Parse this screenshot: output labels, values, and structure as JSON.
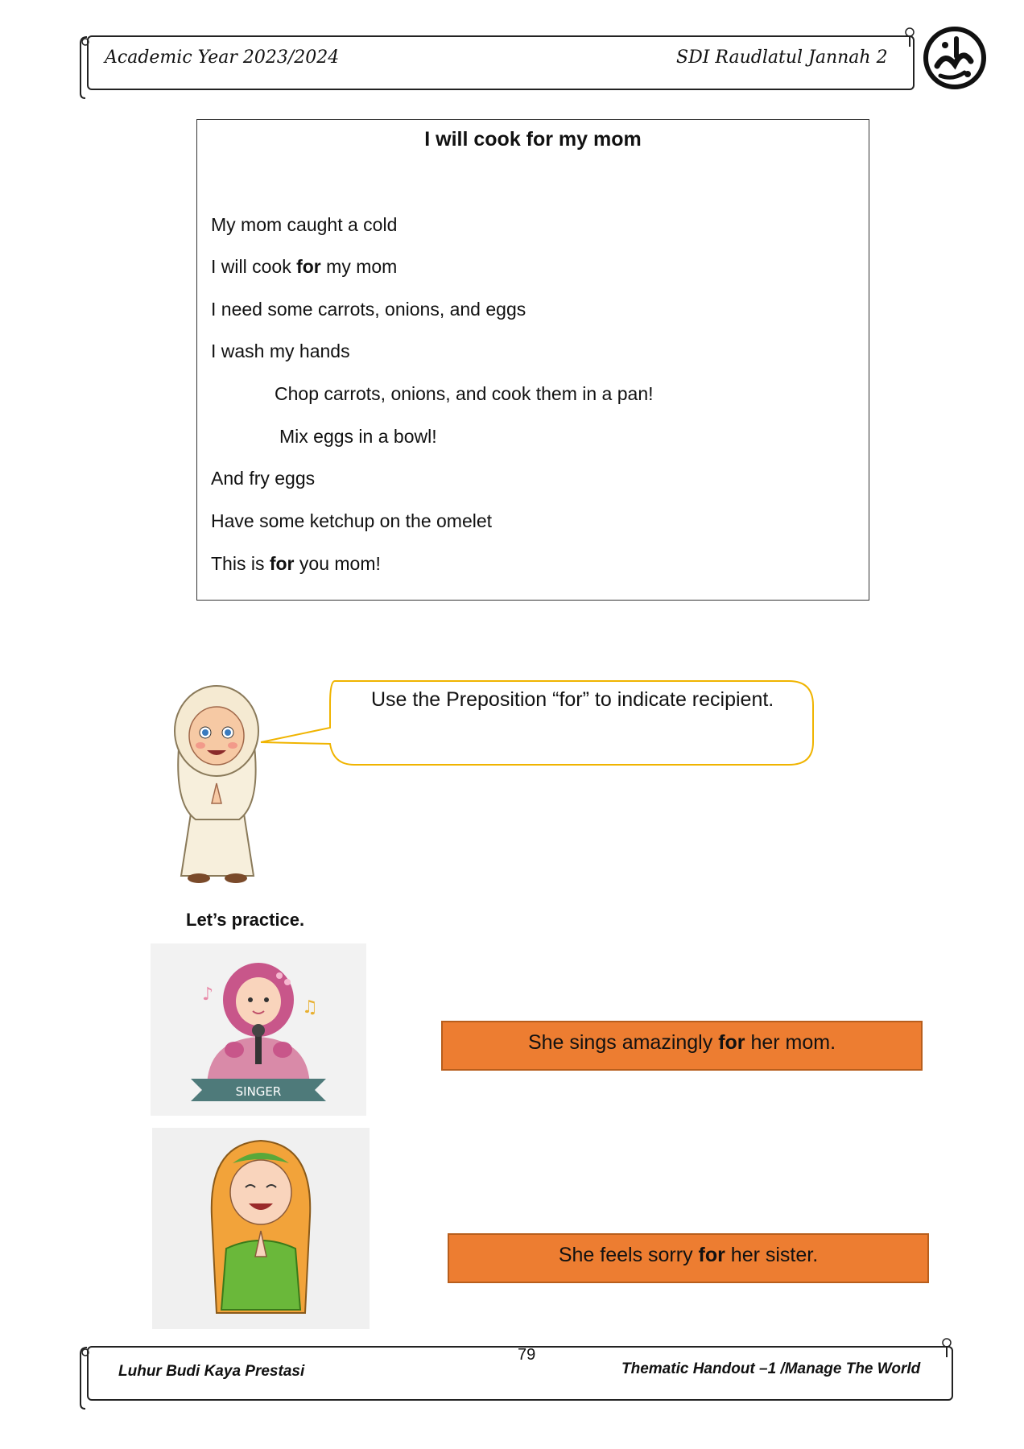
{
  "header": {
    "academic_year": "Academic Year 2023/2024",
    "school_name": "SDI  Raudlatul Jannah 2"
  },
  "story": {
    "title": "I will cook for my mom",
    "lines": [
      {
        "before": "My mom caught a cold",
        "bold": "",
        "after": ""
      },
      {
        "before": "I will cook ",
        "bold": "for",
        "after": " my mom"
      },
      {
        "before": "I need some carrots, onions, and eggs",
        "bold": "",
        "after": ""
      },
      {
        "before": "I wash my hands",
        "bold": "",
        "after": ""
      },
      {
        "before": "Chop carrots, onions, and cook them in a pan!",
        "bold": "",
        "after": ""
      },
      {
        "before": "Mix eggs in a bowl!",
        "bold": "",
        "after": ""
      },
      {
        "before": "And fry eggs",
        "bold": "",
        "after": ""
      },
      {
        "before": "Have some ketchup on the omelet",
        "bold": "",
        "after": ""
      },
      {
        "before": "This is ",
        "bold": "for",
        "after": " you mom!"
      }
    ]
  },
  "speech_bubble": {
    "text": "Use the Preposition “for” to indicate recipient."
  },
  "practice": {
    "title": "Let’s practice.",
    "singer_banner": "SINGER",
    "sentences": [
      {
        "before": "She sings amazingly ",
        "bold": "for",
        "after": " her mom."
      },
      {
        "before": "She feels sorry ",
        "bold": "for",
        "after": " her sister."
      }
    ]
  },
  "footer": {
    "motto": "Luhur Budi Kaya Prestasi",
    "page_number": "79",
    "handout": "Thematic Handout –1 /Manage The World"
  },
  "colors": {
    "orange_box": "#ed7d31",
    "bubble_border": "#f0b400"
  }
}
